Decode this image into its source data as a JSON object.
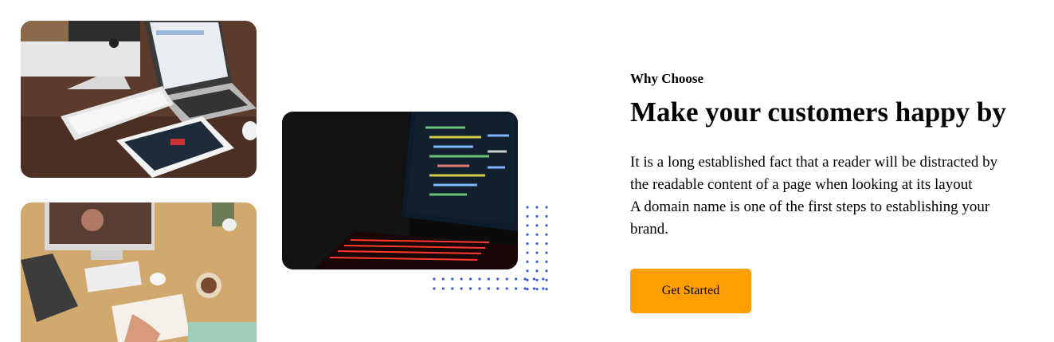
{
  "section": {
    "eyebrow": "Why Choose",
    "headline": "Make your customers happy by",
    "paragraph_lines": [
      "It is a long established fact that a reader will be distracted by",
      "the readable content of a page when looking at its layout",
      "A domain name is one of the first steps to establishing your",
      "brand."
    ],
    "button_label": "Get Started"
  },
  "colors": {
    "accent": "#ff9e00",
    "dots": "#3b5bd9"
  },
  "images": [
    "desk-with-computers-photo",
    "workspace-overhead-photo",
    "laptop-code-photo"
  ]
}
